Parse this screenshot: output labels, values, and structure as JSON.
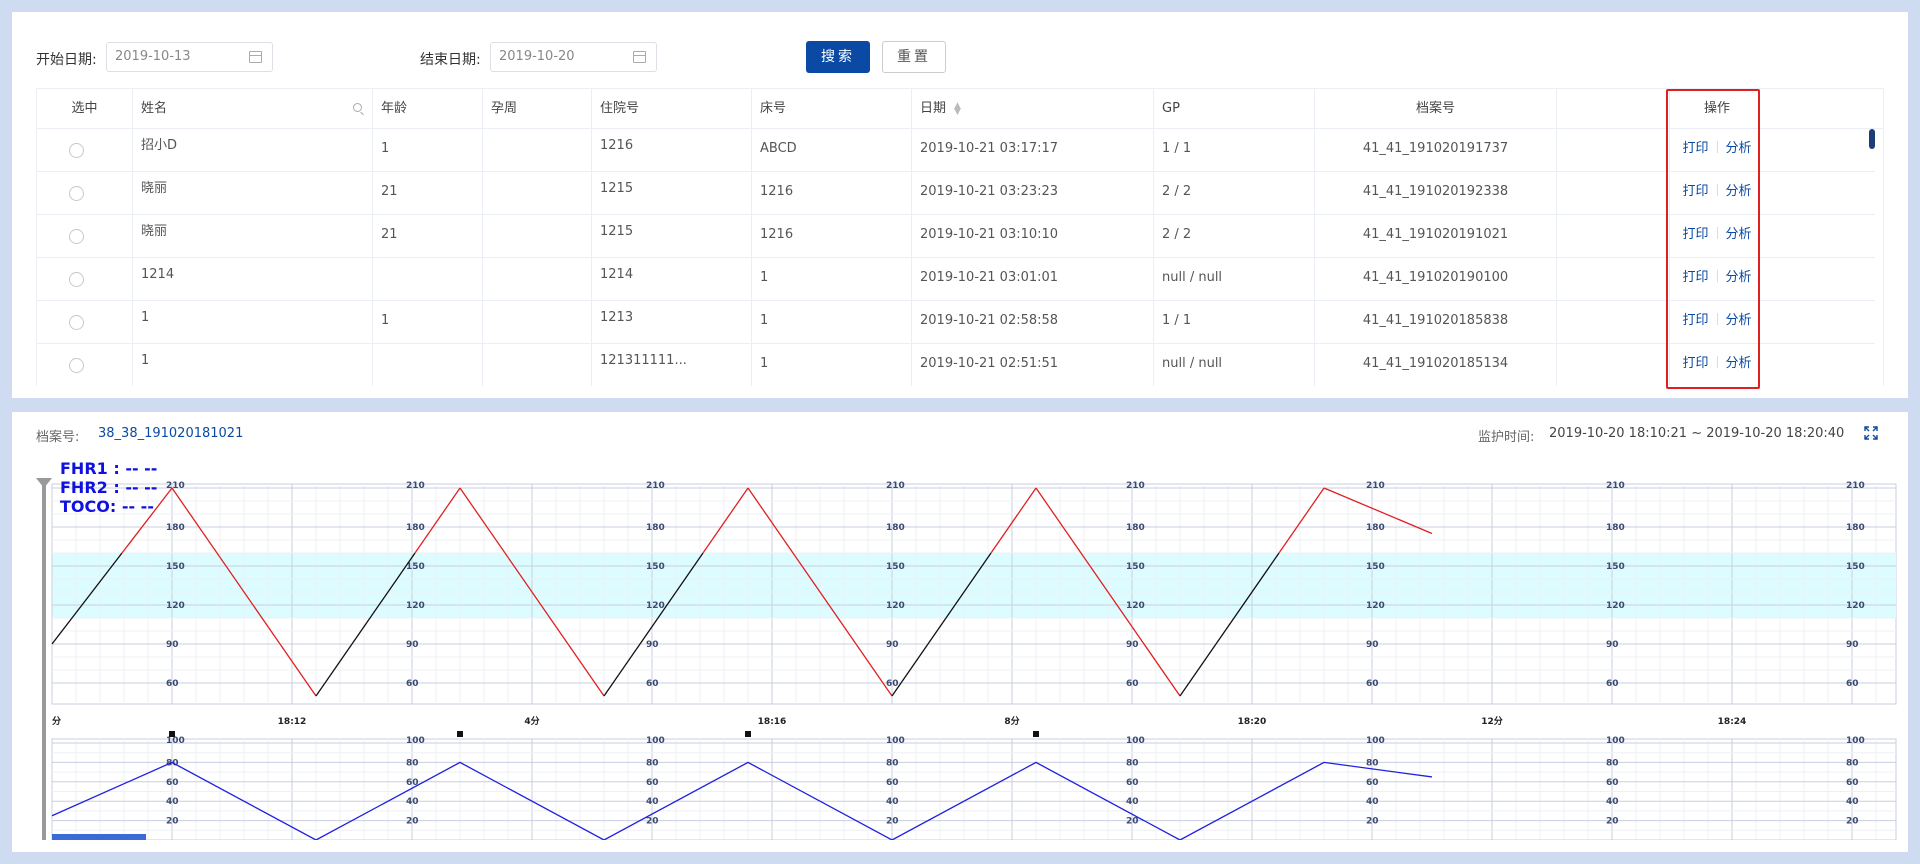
{
  "filters": {
    "start_label": "开始日期:",
    "start_value": "2019-10-13",
    "end_label": "结束日期:",
    "end_value": "2019-10-20",
    "search_button": "搜索",
    "reset_button": "重置"
  },
  "table": {
    "headers": [
      "选中",
      "姓名",
      "年龄",
      "孕周",
      "住院号",
      "床号",
      "日期",
      "GP",
      "档案号",
      "",
      "操作"
    ],
    "rows": [
      {
        "name": "招小D",
        "age": "1",
        "week": "",
        "hospital_no": "1216",
        "bed": "ABCD",
        "date": "2019-10-21 03:17:17",
        "gp": "1 / 1",
        "archive": "41_41_191020191737"
      },
      {
        "name": "晓丽",
        "age": "21",
        "week": "",
        "hospital_no": "1215",
        "bed": "1216",
        "date": "2019-10-21 03:23:23",
        "gp": "2 / 2",
        "archive": "41_41_191020192338"
      },
      {
        "name": "晓丽",
        "age": "21",
        "week": "",
        "hospital_no": "1215",
        "bed": "1216",
        "date": "2019-10-21 03:10:10",
        "gp": "2 / 2",
        "archive": "41_41_191020191021"
      },
      {
        "name": "1214",
        "age": "",
        "week": "",
        "hospital_no": "1214",
        "bed": "1",
        "date": "2019-10-21 03:01:01",
        "gp": "null / null",
        "archive": "41_41_191020190100"
      },
      {
        "name": "1",
        "age": "1",
        "week": "",
        "hospital_no": "1213",
        "bed": "1",
        "date": "2019-10-21 02:58:58",
        "gp": "1 / 1",
        "archive": "41_41_191020185838"
      },
      {
        "name": "1",
        "age": "",
        "week": "",
        "hospital_no": "121311111...",
        "bed": "1",
        "date": "2019-10-21 02:51:51",
        "gp": "null / null",
        "archive": "41_41_191020185134"
      }
    ],
    "op_print": "打印",
    "op_analyze": "分析"
  },
  "monitor": {
    "archive_label": "档案号:",
    "archive_value": "38_38_191020181021",
    "time_label": "监护时间:",
    "time_value": "2019-10-20 18:10:21 ~ 2019-10-20 18:20:40",
    "fhr1": "FHR1 : -- --",
    "fhr2": "FHR2 : -- --",
    "toco": "TOCO: -- --"
  },
  "chart_data": {
    "type": "line",
    "top_axis": {
      "ticks": [
        210,
        180,
        150,
        120,
        90,
        60
      ],
      "normal_band": [
        110,
        160
      ],
      "ylim": [
        50,
        210
      ]
    },
    "bottom_axis": {
      "ticks": [
        100,
        80,
        60,
        40,
        20
      ],
      "ylim": [
        0,
        100
      ]
    },
    "time_labels": [
      "分",
      "18:12",
      "4分",
      "18:16",
      "8分",
      "18:20",
      "12分",
      "18:24"
    ],
    "series": [
      {
        "values_x_min": [
          0,
          1,
          2.2,
          3.4,
          4.6,
          5.8,
          7.0,
          8.2,
          9.4,
          10.6,
          11.5
        ],
        "values": [
          90,
          210,
          50,
          210,
          50,
          210,
          50,
          210,
          50,
          210,
          175
        ],
        "color": "#e02020"
      },
      {
        "values_x_min": [
          0,
          1,
          2.2,
          3.4,
          4.6,
          5.8,
          7.0,
          8.2,
          9.4,
          10.6,
          11.5
        ],
        "values": [
          25,
          80,
          0,
          80,
          0,
          80,
          0,
          80,
          0,
          80,
          65
        ],
        "color": "#2020e0"
      }
    ],
    "event_marks_min": [
      1,
      3.4,
      5.8,
      8.2
    ]
  }
}
